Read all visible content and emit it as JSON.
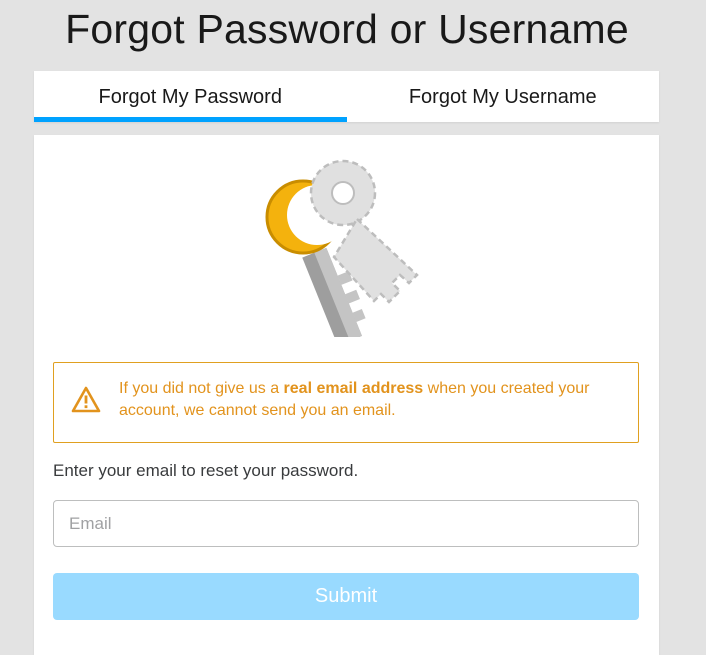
{
  "page": {
    "title": "Forgot Password or Username"
  },
  "tabs": [
    {
      "label": "Forgot My Password",
      "active": true
    },
    {
      "label": "Forgot My Username",
      "active": false
    }
  ],
  "illustration": {
    "icon": "key-icon"
  },
  "warning": {
    "icon": "warning-triangle-icon",
    "text_before": "If you did not give us a ",
    "text_bold": "real email address",
    "text_after": " when you created your account, we cannot send you an email."
  },
  "form": {
    "instruction": "Enter your email to reset your password.",
    "email_placeholder": "Email",
    "email_value": "",
    "submit_label": "Submit"
  },
  "colors": {
    "accent": "#00a2ff",
    "warning": "#e2931d",
    "submit_disabled": "#99daff"
  }
}
